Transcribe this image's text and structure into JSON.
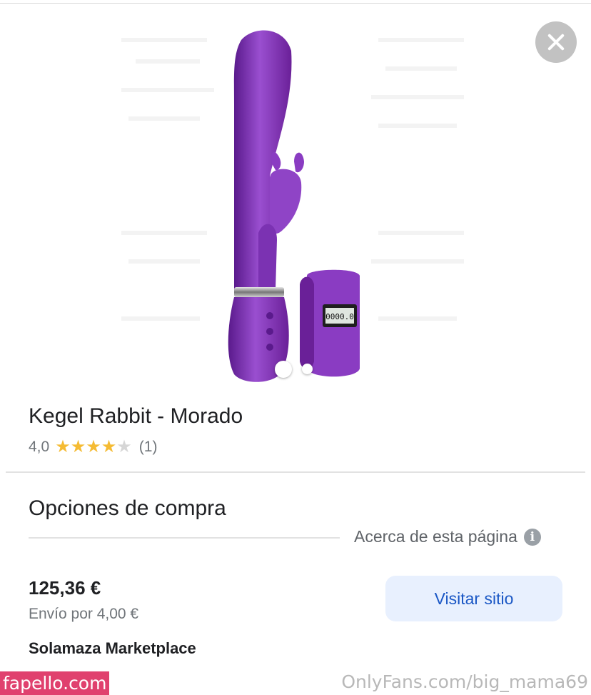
{
  "product": {
    "title": "Kegel Rabbit - Morado",
    "rating_value": "4,0",
    "stars_filled": 4,
    "stars_total": 5,
    "review_count": "(1)",
    "remote_display": "0000.0"
  },
  "carousel": {
    "slides": 2,
    "active": 1
  },
  "purchase": {
    "section_title": "Opciones de compra",
    "about_label": "Acerca de esta página",
    "price": "125,36 €",
    "shipping": "Envío por 4,00 €",
    "seller": "Solamaza Marketplace",
    "visit_label": "Visitar sitio"
  },
  "watermarks": {
    "left": "fapello.com",
    "right": "OnlyFans.com/big_mama69"
  },
  "icons": {
    "close": "close-icon",
    "info": "info-icon",
    "star": "star-icon"
  },
  "colors": {
    "accent_purple": "#7a2fb0",
    "star": "#f5bb33",
    "button_bg": "#e8f0fe",
    "button_text": "#1a57c5"
  }
}
